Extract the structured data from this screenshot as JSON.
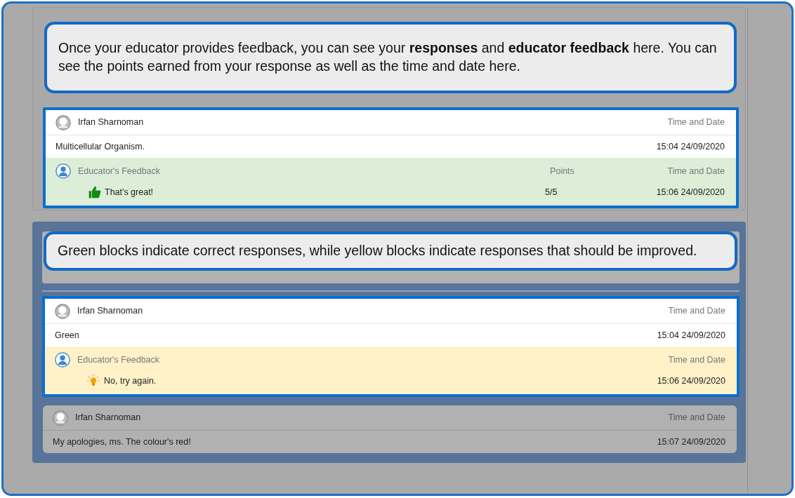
{
  "sections": [
    {
      "callout": "Once your educator provides feedback, you can see your **responses** and **educator feedback** here. You can see the points earned from your response as well as the time and date here.",
      "boxed": false,
      "cards": [
        {
          "author": "Irfan Sharnoman",
          "time_label": "Time and Date",
          "response": "Multicellular Organism.",
          "time": "15:04 24/09/2020",
          "highlighted": true,
          "feedback": {
            "kind": "correct",
            "title": "Educator's Feedback",
            "points_label": "Points",
            "time_label": "Time and Date",
            "comment": "That's great!",
            "points": "5/5",
            "time": "15:06 24/09/2020"
          }
        }
      ]
    },
    {
      "callout": "Green blocks indicate correct responses, while yellow blocks indicate responses that should be improved.",
      "boxed": true,
      "cards": [
        {
          "author": "Irfan Sharnoman",
          "time_label": "Time and Date",
          "response": "Green",
          "time": "15:04 24/09/2020",
          "highlighted": true,
          "feedback": {
            "kind": "improve",
            "title": "Educator's Feedback",
            "time_label": "Time and Date",
            "comment": "No, try again.",
            "time": "15:06 24/09/2020"
          }
        },
        {
          "author": "Irfan Sharnoman",
          "time_label": "Time and Date",
          "response": "My apologies, ms. The colour's red!",
          "time": "15:07 24/09/2020",
          "highlighted": false
        }
      ]
    }
  ]
}
